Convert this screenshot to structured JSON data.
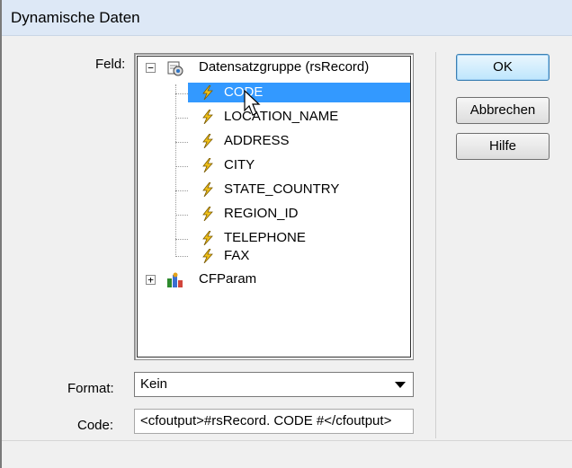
{
  "dialog": {
    "title": "Dynamische Daten",
    "feld_label": "Feld:",
    "format_label": "Format:",
    "code_label": "Code:"
  },
  "tree": {
    "root": {
      "label": "Datensatzgruppe (rsRecord)",
      "expander": "−",
      "icon": "recordset-icon"
    },
    "fields": [
      {
        "label": "CODE",
        "selected": true,
        "icon": "lightning-bolt-icon"
      },
      {
        "label": "LOCATION_NAME",
        "selected": false,
        "icon": "lightning-bolt-icon"
      },
      {
        "label": "ADDRESS",
        "selected": false,
        "icon": "lightning-bolt-icon"
      },
      {
        "label": "CITY",
        "selected": false,
        "icon": "lightning-bolt-icon"
      },
      {
        "label": "STATE_COUNTRY",
        "selected": false,
        "icon": "lightning-bolt-icon"
      },
      {
        "label": "REGION_ID",
        "selected": false,
        "icon": "lightning-bolt-icon"
      },
      {
        "label": "TELEPHONE",
        "selected": false,
        "icon": "lightning-bolt-icon"
      },
      {
        "label": "FAX",
        "selected": false,
        "icon": "lightning-bolt-icon"
      }
    ],
    "second": {
      "label": "CFParam",
      "expander": "+",
      "icon": "cfparam-icon"
    }
  },
  "format": {
    "value": "Kein"
  },
  "code": {
    "value": "<cfoutput>#rsRecord. CODE #</cfoutput>"
  },
  "buttons": {
    "ok": "OK",
    "cancel": "Abbrechen",
    "help": "Hilfe"
  },
  "colors": {
    "selection": "#3399ff",
    "titlebar": "#dde8f6",
    "dialog_bg": "#f0f0f0"
  }
}
